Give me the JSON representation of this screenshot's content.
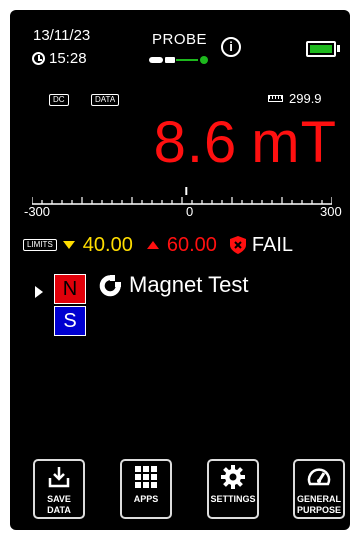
{
  "status_bar": {
    "date": "13/11/23",
    "time": "15:28",
    "probe_label": "PROBE",
    "info_icon": "info-icon",
    "battery_icon": "battery-full-icon",
    "battery_color": "#1db81d"
  },
  "mode_tags": {
    "dc": "DC",
    "data": "DATA"
  },
  "memory": {
    "icon": "ruler-icon",
    "value": "299.9"
  },
  "reading": {
    "value": "8.6",
    "unit": "mT",
    "color": "#ff1010"
  },
  "scale": {
    "min_label": "-300",
    "mid_label": "0",
    "max_label": "300",
    "needle_value": 8.6
  },
  "limits": {
    "tag": "LIMITS",
    "low": "40.00",
    "low_color": "#ffdd00",
    "high": "60.00",
    "high_color": "#ff1010",
    "result": "FAIL"
  },
  "app": {
    "pole_north": "N",
    "pole_south": "S",
    "icon": "magnet-icon",
    "name": "Magnet Test"
  },
  "buttons": [
    {
      "icon": "save-data-icon",
      "label_line1": "SAVE",
      "label_line2": "DATA"
    },
    {
      "icon": "apps-grid-icon",
      "label_line1": "APPS",
      "label_line2": ""
    },
    {
      "icon": "gear-icon",
      "label_line1": "SETTINGS",
      "label_line2": ""
    },
    {
      "icon": "speedometer-icon",
      "label_line1": "GENERAL",
      "label_line2": "PURPOSE"
    }
  ]
}
